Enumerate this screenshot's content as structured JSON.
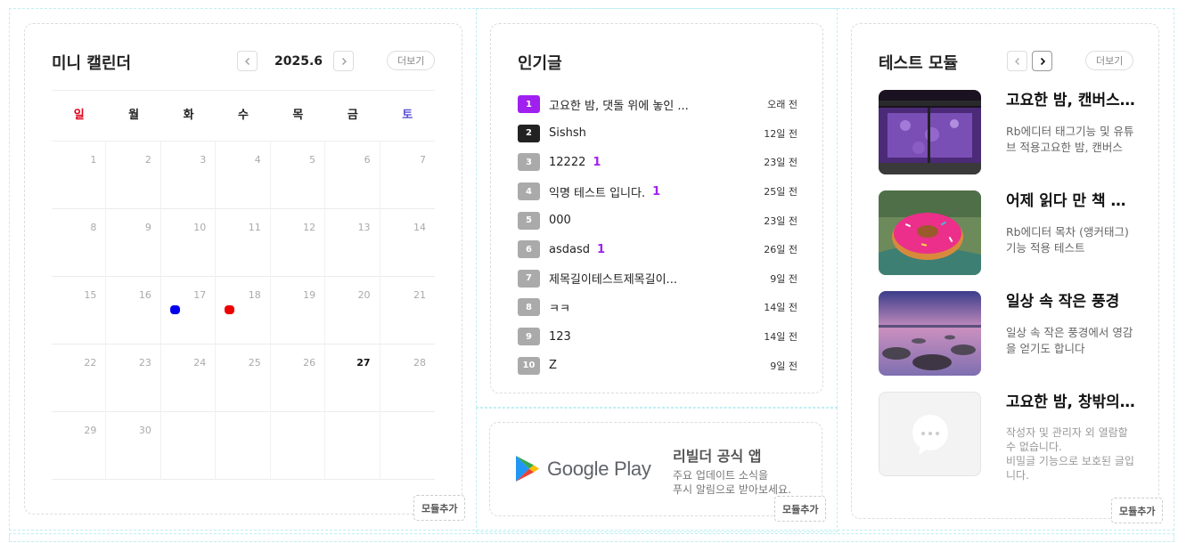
{
  "calendar": {
    "title": "미니 캘린더",
    "month": "2025.6",
    "more_label": "더보기",
    "add_label": "모듈추가",
    "weekdays": [
      "일",
      "월",
      "화",
      "수",
      "목",
      "금",
      "토"
    ],
    "weekday_colors": {
      "sun": "#e0001b",
      "sat": "#5a52d6",
      "default": "#222222"
    },
    "days": [
      1,
      2,
      3,
      4,
      5,
      6,
      7,
      8,
      9,
      10,
      11,
      12,
      13,
      14,
      15,
      16,
      17,
      18,
      19,
      20,
      21,
      22,
      23,
      24,
      25,
      26,
      27,
      28,
      29,
      30
    ],
    "today": 27,
    "events": [
      {
        "day": 17,
        "color": "#0000ee"
      },
      {
        "day": 18,
        "color": "#ee0000"
      }
    ]
  },
  "popular": {
    "title": "인기글",
    "add_label": "모듈추가",
    "items": [
      {
        "rank": "1",
        "title": "고요한 밤, 댓돌 위에 놓인 ...",
        "count": "",
        "time": "오래 전",
        "color": "#a020f0"
      },
      {
        "rank": "2",
        "title": "Sishsh",
        "count": "",
        "time": "12일 전",
        "color": "#222222"
      },
      {
        "rank": "3",
        "title": "12222",
        "count": "1",
        "time": "23일 전",
        "color": "#aaaaaa"
      },
      {
        "rank": "4",
        "title": "익명 테스트 입니다.",
        "count": "1",
        "time": "25일 전",
        "color": "#aaaaaa"
      },
      {
        "rank": "5",
        "title": "000",
        "count": "",
        "time": "23일 전",
        "color": "#aaaaaa"
      },
      {
        "rank": "6",
        "title": "asdasd",
        "count": "1",
        "time": "26일 전",
        "color": "#aaaaaa"
      },
      {
        "rank": "7",
        "title": "제목길이테스트제목길이...",
        "count": "",
        "time": "9일 전",
        "color": "#aaaaaa"
      },
      {
        "rank": "8",
        "title": "ㅋㅋ",
        "count": "",
        "time": "14일 전",
        "color": "#aaaaaa"
      },
      {
        "rank": "9",
        "title": "123",
        "count": "",
        "time": "14일 전",
        "color": "#aaaaaa"
      },
      {
        "rank": "10",
        "title": "Z",
        "count": "",
        "time": "9일 전",
        "color": "#aaaaaa"
      }
    ]
  },
  "app": {
    "store_label": "Google Play",
    "title": "리빌더 공식 앱",
    "desc": "주요 업데이트 소식을\n푸시 알림으로 받아보세요.",
    "add_label": "모듈추가"
  },
  "test": {
    "title": "테스트 모듈",
    "more_label": "더보기",
    "add_label": "모듈추가",
    "items": [
      {
        "title": "고요한 밤, 캔버스 위에",
        "desc": "Rb에디터 태그기능 및 유튜브 적용고요한 밤, 캔버스",
        "thumb": "purple-window",
        "secret": false
      },
      {
        "title": "어제 읽다 만 책 한 권",
        "desc": "Rb에디터 목차 (앵커태그) 기능 적용 테스트",
        "thumb": "donut",
        "secret": false
      },
      {
        "title": "일상 속 작은 풍경",
        "desc": "일상 속 작은 풍경에서 영감을 얻기도 합니다",
        "thumb": "sunset-rocks",
        "secret": false
      },
      {
        "title": "고요한 밤, 창밖의 풍경",
        "desc": "작성자 및 관리자 외 열람할 수 없습니다.\n비밀글 기능으로 보호된 글입니다.",
        "thumb": "chat-placeholder",
        "secret": true
      }
    ]
  }
}
